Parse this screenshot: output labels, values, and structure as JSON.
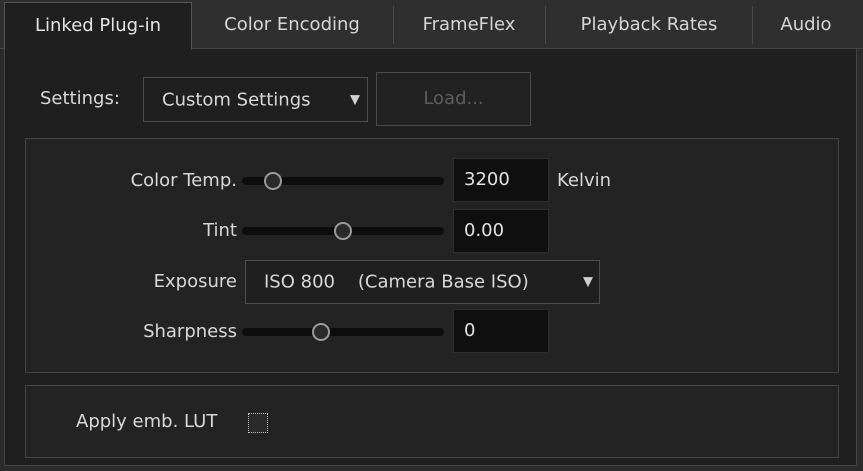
{
  "tabs": [
    {
      "label": "Linked Plug-in",
      "active": true
    },
    {
      "label": "Color Encoding",
      "active": false
    },
    {
      "label": "FrameFlex",
      "active": false
    },
    {
      "label": "Playback Rates",
      "active": false
    },
    {
      "label": "Audio",
      "active": false
    }
  ],
  "settings": {
    "label": "Settings:",
    "selected": "Custom Settings",
    "load_label": "Load..."
  },
  "params": {
    "color_temp": {
      "label": "Color Temp.",
      "value": "3200",
      "unit": "Kelvin",
      "slider_fraction": 0.12
    },
    "tint": {
      "label": "Tint",
      "value": "0.00",
      "slider_fraction": 0.5
    },
    "exposure": {
      "label": "Exposure",
      "selected": "ISO 800    (Camera Base ISO)"
    },
    "sharpness": {
      "label": "Sharpness",
      "value": "0",
      "slider_fraction": 0.38
    }
  },
  "lut": {
    "label": "Apply emb. LUT",
    "checked": false
  },
  "colors": {
    "background": "#1f1f1f",
    "text": "#d8d8d8",
    "field": "#0f0f0f"
  }
}
